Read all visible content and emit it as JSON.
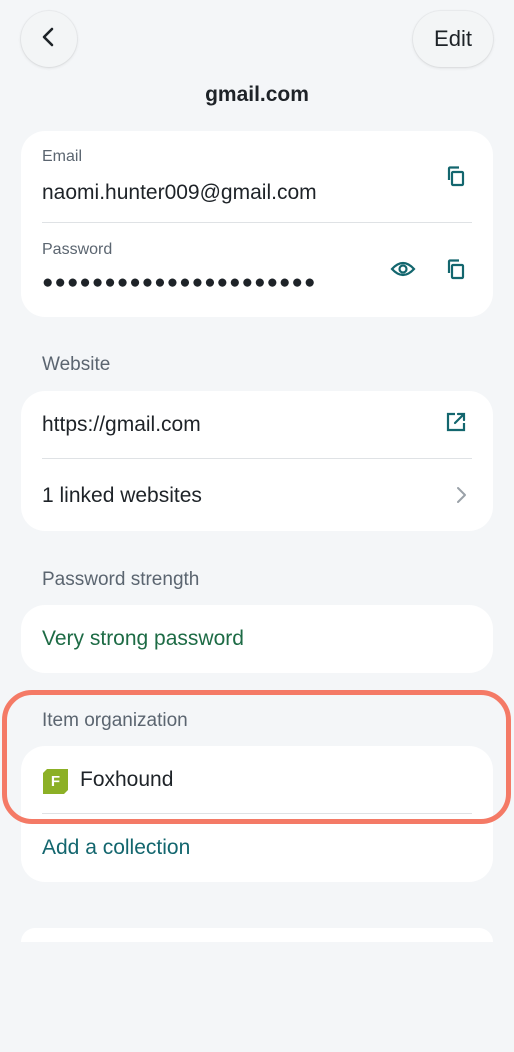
{
  "header": {
    "back_icon": "chevron-left-icon",
    "edit_label": "Edit",
    "title": "gmail.com"
  },
  "credentials": {
    "email_label": "Email",
    "email_value": "naomi.hunter009@gmail.com",
    "password_label": "Password",
    "password_value": "●●●●●●●●●●●●●●●●●●●●●●",
    "icons": [
      "copy-icon",
      "eye-icon"
    ]
  },
  "website": {
    "section_label": "Website",
    "url": "https://gmail.com",
    "linked": "1 linked websites",
    "icons": [
      "external-link-icon",
      "chevron-right-icon"
    ]
  },
  "strength": {
    "section_label": "Password strength",
    "value": "Very strong password"
  },
  "organization": {
    "section_label": "Item organization",
    "badge_letter": "F",
    "badge_color": "#8cb026",
    "name": "Foxhound",
    "add_collection": "Add a collection"
  },
  "colors": {
    "accent": "#13666e",
    "strength_green": "#1d6b45",
    "highlight": "#f47a66",
    "background": "#f4f6f8"
  }
}
